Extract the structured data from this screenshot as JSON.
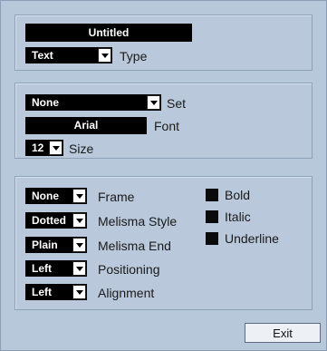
{
  "section1": {
    "title_value": "Untitled",
    "type_value": "Text",
    "type_label": "Type"
  },
  "section2": {
    "set_value": "None",
    "set_label": "Set",
    "font_value": "Arial",
    "font_label": "Font",
    "size_value": "12",
    "size_label": "Size"
  },
  "section3": {
    "frame_value": "None",
    "frame_label": "Frame",
    "melisma_style_value": "Dotted",
    "melisma_style_label": "Melisma Style",
    "melisma_end_value": "Plain",
    "melisma_end_label": "Melisma End",
    "positioning_value": "Left",
    "positioning_label": "Positioning",
    "alignment_value": "Left",
    "alignment_label": "Alignment",
    "bold_label": "Bold",
    "italic_label": "Italic",
    "underline_label": "Underline"
  },
  "exit_label": "Exit"
}
